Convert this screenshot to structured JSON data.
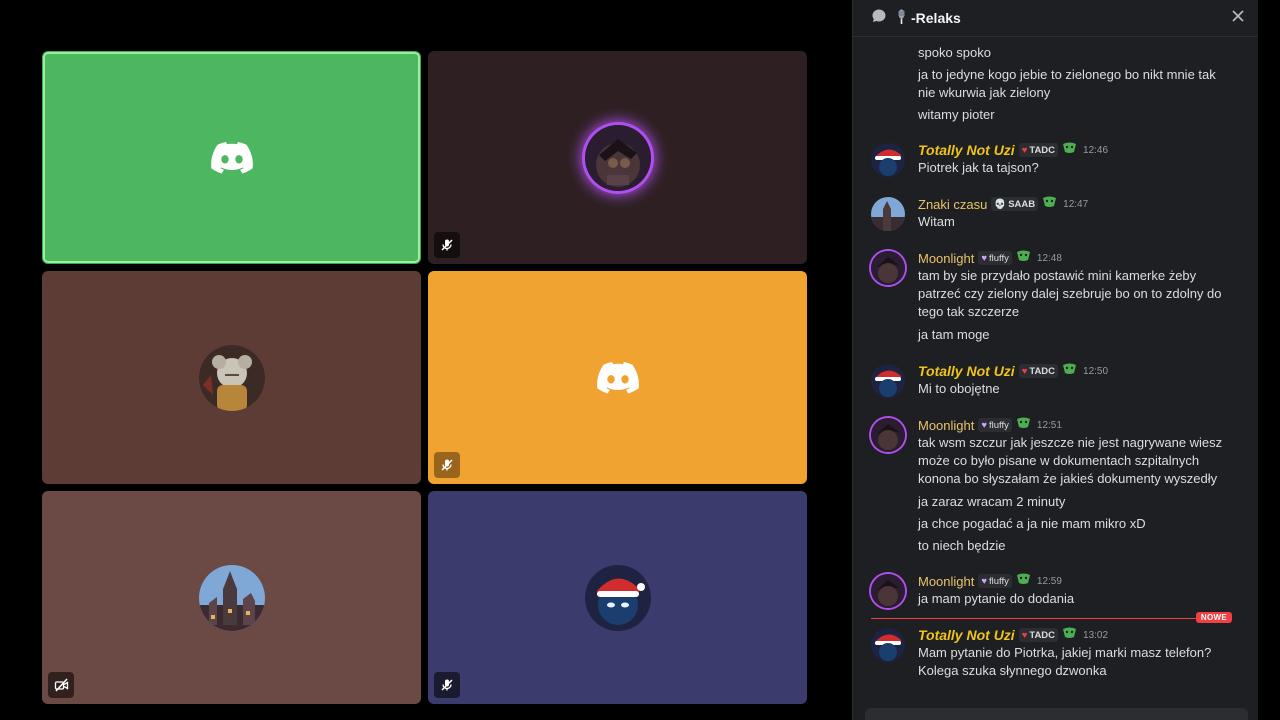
{
  "chat": {
    "channel_name": "-Relaks",
    "messages_top": [
      "spoko spoko",
      "ja to jedyne kogo jebie to zielonego bo nikt mnie tak nie wkurwia jak zielony",
      "witamy pioter"
    ],
    "groups": [
      {
        "author": "Totally Not Uzi",
        "tag": "TADC",
        "time": "12:46",
        "lines": [
          "Piotrek jak ta tajson?"
        ]
      },
      {
        "author": "Znaki czasu",
        "tag": "SAAB",
        "time": "12:47",
        "lines": [
          "Witam"
        ]
      },
      {
        "author": "Moonlight",
        "tag": "fluffy",
        "time": "12:48",
        "lines": [
          "tam by sie przydało postawić mini kamerke żeby patrzeć czy zielony dalej szebruje bo on to zdolny do tego tak szczerze",
          "ja tam moge"
        ]
      },
      {
        "author": "Totally Not Uzi",
        "tag": "TADC",
        "time": "12:50",
        "lines": [
          "Mi to obojętne"
        ]
      },
      {
        "author": "Moonlight",
        "tag": "fluffy",
        "time": "12:51",
        "lines": [
          "tak wsm szczur jak jeszcze nie jest nagrywane wiesz może co było pisane w dokumentach szpitalnych konona bo słyszałam że jakieś dokumenty wyszedły",
          "ja zaraz wracam 2 minuty",
          "ja chce pogadać a ja nie mam mikro xD",
          "to niech będzie"
        ]
      },
      {
        "author": "Moonlight",
        "tag": "fluffy",
        "time": "12:59",
        "lines": [
          "ja mam pytanie do dodania"
        ]
      },
      {
        "author": "Totally Not Uzi",
        "tag": "TADC",
        "time": "13:02",
        "lines": [
          "Mam pytanie do Piotrka, jakiej marki masz telefon? Kolega szuka słynnego dzwonka"
        ]
      }
    ],
    "new_badge": "NOWE"
  },
  "colors": {
    "tile_green": "#4db660",
    "tile_dark": "#2e2022",
    "tile_brown": "#5e3c36",
    "tile_orange": "#f1a332",
    "tile_rose": "#6b4a46",
    "tile_indigo": "#3b3b6d",
    "accent_red": "#f23f43"
  },
  "icons": [
    "chat-bubble-icon",
    "microphone-emoji-icon",
    "close-icon",
    "discord-logo-icon",
    "mic-muted-icon",
    "camera-off-icon",
    "heart-icon",
    "skull-icon",
    "mask-badge-icon"
  ]
}
